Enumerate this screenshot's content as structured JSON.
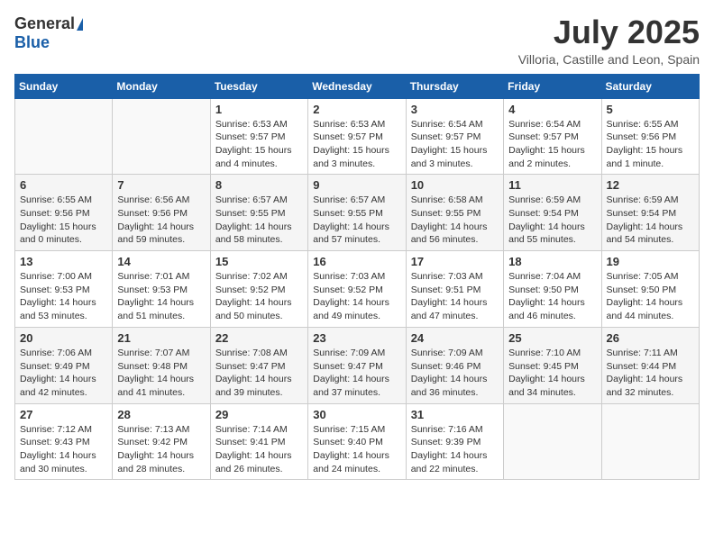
{
  "logo": {
    "general": "General",
    "blue": "Blue"
  },
  "header": {
    "month_title": "July 2025",
    "subtitle": "Villoria, Castille and Leon, Spain"
  },
  "weekdays": [
    "Sunday",
    "Monday",
    "Tuesday",
    "Wednesday",
    "Thursday",
    "Friday",
    "Saturday"
  ],
  "weeks": [
    [
      {
        "day": "",
        "sunrise": "",
        "sunset": "",
        "daylight": ""
      },
      {
        "day": "",
        "sunrise": "",
        "sunset": "",
        "daylight": ""
      },
      {
        "day": "1",
        "sunrise": "Sunrise: 6:53 AM",
        "sunset": "Sunset: 9:57 PM",
        "daylight": "Daylight: 15 hours and 4 minutes."
      },
      {
        "day": "2",
        "sunrise": "Sunrise: 6:53 AM",
        "sunset": "Sunset: 9:57 PM",
        "daylight": "Daylight: 15 hours and 3 minutes."
      },
      {
        "day": "3",
        "sunrise": "Sunrise: 6:54 AM",
        "sunset": "Sunset: 9:57 PM",
        "daylight": "Daylight: 15 hours and 3 minutes."
      },
      {
        "day": "4",
        "sunrise": "Sunrise: 6:54 AM",
        "sunset": "Sunset: 9:57 PM",
        "daylight": "Daylight: 15 hours and 2 minutes."
      },
      {
        "day": "5",
        "sunrise": "Sunrise: 6:55 AM",
        "sunset": "Sunset: 9:56 PM",
        "daylight": "Daylight: 15 hours and 1 minute."
      }
    ],
    [
      {
        "day": "6",
        "sunrise": "Sunrise: 6:55 AM",
        "sunset": "Sunset: 9:56 PM",
        "daylight": "Daylight: 15 hours and 0 minutes."
      },
      {
        "day": "7",
        "sunrise": "Sunrise: 6:56 AM",
        "sunset": "Sunset: 9:56 PM",
        "daylight": "Daylight: 14 hours and 59 minutes."
      },
      {
        "day": "8",
        "sunrise": "Sunrise: 6:57 AM",
        "sunset": "Sunset: 9:55 PM",
        "daylight": "Daylight: 14 hours and 58 minutes."
      },
      {
        "day": "9",
        "sunrise": "Sunrise: 6:57 AM",
        "sunset": "Sunset: 9:55 PM",
        "daylight": "Daylight: 14 hours and 57 minutes."
      },
      {
        "day": "10",
        "sunrise": "Sunrise: 6:58 AM",
        "sunset": "Sunset: 9:55 PM",
        "daylight": "Daylight: 14 hours and 56 minutes."
      },
      {
        "day": "11",
        "sunrise": "Sunrise: 6:59 AM",
        "sunset": "Sunset: 9:54 PM",
        "daylight": "Daylight: 14 hours and 55 minutes."
      },
      {
        "day": "12",
        "sunrise": "Sunrise: 6:59 AM",
        "sunset": "Sunset: 9:54 PM",
        "daylight": "Daylight: 14 hours and 54 minutes."
      }
    ],
    [
      {
        "day": "13",
        "sunrise": "Sunrise: 7:00 AM",
        "sunset": "Sunset: 9:53 PM",
        "daylight": "Daylight: 14 hours and 53 minutes."
      },
      {
        "day": "14",
        "sunrise": "Sunrise: 7:01 AM",
        "sunset": "Sunset: 9:53 PM",
        "daylight": "Daylight: 14 hours and 51 minutes."
      },
      {
        "day": "15",
        "sunrise": "Sunrise: 7:02 AM",
        "sunset": "Sunset: 9:52 PM",
        "daylight": "Daylight: 14 hours and 50 minutes."
      },
      {
        "day": "16",
        "sunrise": "Sunrise: 7:03 AM",
        "sunset": "Sunset: 9:52 PM",
        "daylight": "Daylight: 14 hours and 49 minutes."
      },
      {
        "day": "17",
        "sunrise": "Sunrise: 7:03 AM",
        "sunset": "Sunset: 9:51 PM",
        "daylight": "Daylight: 14 hours and 47 minutes."
      },
      {
        "day": "18",
        "sunrise": "Sunrise: 7:04 AM",
        "sunset": "Sunset: 9:50 PM",
        "daylight": "Daylight: 14 hours and 46 minutes."
      },
      {
        "day": "19",
        "sunrise": "Sunrise: 7:05 AM",
        "sunset": "Sunset: 9:50 PM",
        "daylight": "Daylight: 14 hours and 44 minutes."
      }
    ],
    [
      {
        "day": "20",
        "sunrise": "Sunrise: 7:06 AM",
        "sunset": "Sunset: 9:49 PM",
        "daylight": "Daylight: 14 hours and 42 minutes."
      },
      {
        "day": "21",
        "sunrise": "Sunrise: 7:07 AM",
        "sunset": "Sunset: 9:48 PM",
        "daylight": "Daylight: 14 hours and 41 minutes."
      },
      {
        "day": "22",
        "sunrise": "Sunrise: 7:08 AM",
        "sunset": "Sunset: 9:47 PM",
        "daylight": "Daylight: 14 hours and 39 minutes."
      },
      {
        "day": "23",
        "sunrise": "Sunrise: 7:09 AM",
        "sunset": "Sunset: 9:47 PM",
        "daylight": "Daylight: 14 hours and 37 minutes."
      },
      {
        "day": "24",
        "sunrise": "Sunrise: 7:09 AM",
        "sunset": "Sunset: 9:46 PM",
        "daylight": "Daylight: 14 hours and 36 minutes."
      },
      {
        "day": "25",
        "sunrise": "Sunrise: 7:10 AM",
        "sunset": "Sunset: 9:45 PM",
        "daylight": "Daylight: 14 hours and 34 minutes."
      },
      {
        "day": "26",
        "sunrise": "Sunrise: 7:11 AM",
        "sunset": "Sunset: 9:44 PM",
        "daylight": "Daylight: 14 hours and 32 minutes."
      }
    ],
    [
      {
        "day": "27",
        "sunrise": "Sunrise: 7:12 AM",
        "sunset": "Sunset: 9:43 PM",
        "daylight": "Daylight: 14 hours and 30 minutes."
      },
      {
        "day": "28",
        "sunrise": "Sunrise: 7:13 AM",
        "sunset": "Sunset: 9:42 PM",
        "daylight": "Daylight: 14 hours and 28 minutes."
      },
      {
        "day": "29",
        "sunrise": "Sunrise: 7:14 AM",
        "sunset": "Sunset: 9:41 PM",
        "daylight": "Daylight: 14 hours and 26 minutes."
      },
      {
        "day": "30",
        "sunrise": "Sunrise: 7:15 AM",
        "sunset": "Sunset: 9:40 PM",
        "daylight": "Daylight: 14 hours and 24 minutes."
      },
      {
        "day": "31",
        "sunrise": "Sunrise: 7:16 AM",
        "sunset": "Sunset: 9:39 PM",
        "daylight": "Daylight: 14 hours and 22 minutes."
      },
      {
        "day": "",
        "sunrise": "",
        "sunset": "",
        "daylight": ""
      },
      {
        "day": "",
        "sunrise": "",
        "sunset": "",
        "daylight": ""
      }
    ]
  ]
}
